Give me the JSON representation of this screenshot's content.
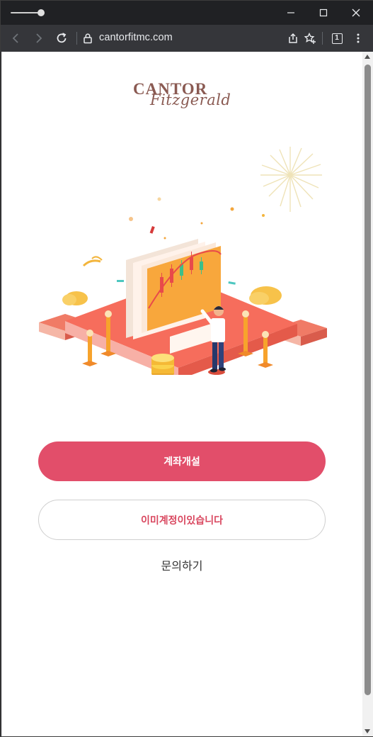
{
  "browser": {
    "url": "cantorfitmc.com",
    "tab_count": "1"
  },
  "logo": {
    "line1": "CANTOR",
    "line2": "Fitzgerald"
  },
  "buttons": {
    "open_account": "계좌개설",
    "have_account": "이미계정이있습니다"
  },
  "links": {
    "inquiry": "문의하기"
  },
  "colors": {
    "primary": "#e24e6a",
    "secondary_text": "#d9475f",
    "logo": "#8a5a52"
  },
  "icons": {
    "back": "arrow-left-icon",
    "forward": "arrow-right-icon",
    "reload": "reload-icon",
    "lock": "lock-icon",
    "share": "share-icon",
    "bookmark": "star-plus-icon",
    "tabs": "tab-counter-icon",
    "menu": "kebab-menu-icon"
  }
}
